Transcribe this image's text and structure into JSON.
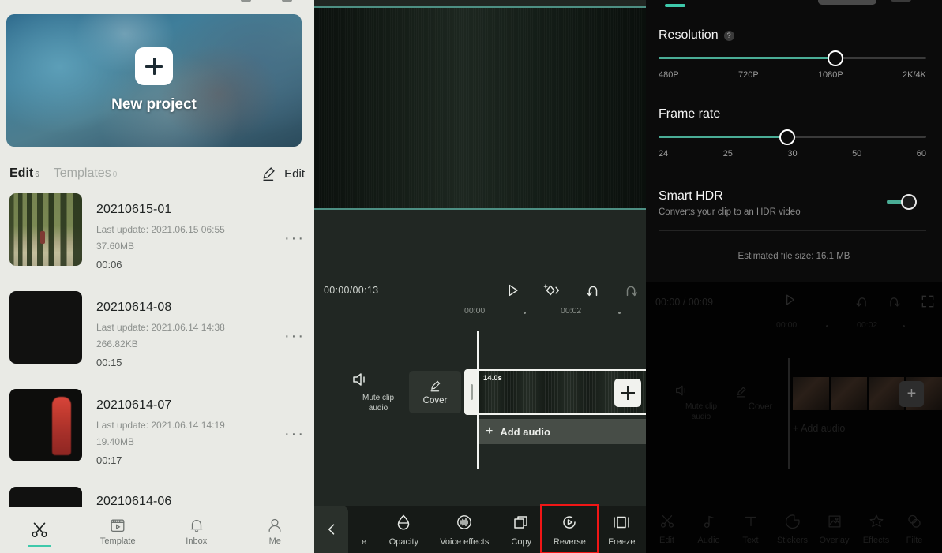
{
  "panels": {
    "projects": {
      "hero": {
        "label": "New project",
        "icon": "plus-icon"
      },
      "tabs": {
        "edit_label": "Edit",
        "edit_count": "6",
        "templates_label": "Templates",
        "templates_count": "0"
      },
      "edit_action": {
        "label": "Edit",
        "icon": "pencil-icon"
      },
      "list_meta": {
        "last_update_prefix": "Last update:"
      },
      "items": [
        {
          "name": "20210615-01",
          "last_update": "Last update: 2021.06.15 06:55",
          "size": "37.60MB",
          "duration": "00:06",
          "thumb": "forest-path",
          "menu": "···"
        },
        {
          "name": "20210614-08",
          "last_update": "Last update: 2021.06.14 14:38",
          "size": "266.82KB",
          "duration": "00:15",
          "thumb": "black",
          "menu": "···"
        },
        {
          "name": "20210614-07",
          "last_update": "Last update: 2021.06.14 14:19",
          "size": "19.40MB",
          "duration": "00:17",
          "thumb": "red-dancer",
          "menu": "···"
        },
        {
          "name": "20210614-06",
          "last_update": "",
          "size": "",
          "duration": "",
          "thumb": "black-cut",
          "menu": ""
        }
      ],
      "bottom_nav": [
        {
          "label": "",
          "icon": "scissors-icon",
          "active": true
        },
        {
          "label": "Template",
          "icon": "template-icon",
          "active": false
        },
        {
          "label": "Inbox",
          "icon": "bell-icon",
          "active": false
        },
        {
          "label": "Me",
          "icon": "person-icon",
          "active": false
        }
      ]
    },
    "editor": {
      "timecode": "00:00/00:13",
      "controls": [
        {
          "name": "play-button",
          "icon": "play-icon"
        },
        {
          "name": "add-keyframe-button",
          "icon": "keyframe-plus-icon"
        },
        {
          "name": "undo-button",
          "icon": "undo-icon"
        },
        {
          "name": "redo-button",
          "icon": "redo-icon"
        }
      ],
      "ruler": {
        "t0": "00:00",
        "t1": "00:02"
      },
      "mute_clip_audio": "Mute clip\naudio",
      "mute_line1": "Mute clip",
      "mute_line2": "audio",
      "cover_label": "Cover",
      "clip_duration": "14.0s",
      "add_clip_label": "+",
      "add_audio_label": "Add audio",
      "add_audio_plus": "+",
      "toolbar": {
        "back_icon": "chevron-left-icon",
        "items": [
          {
            "label": "e",
            "icon": "truncated-icon",
            "highlight": false
          },
          {
            "label": "Opacity",
            "icon": "opacity-icon",
            "highlight": false
          },
          {
            "label": "Voice effects",
            "icon": "voice-effects-icon",
            "highlight": false
          },
          {
            "label": "Copy",
            "icon": "copy-icon",
            "highlight": false
          },
          {
            "label": "Reverse",
            "icon": "reverse-icon",
            "highlight": true
          },
          {
            "label": "Freeze",
            "icon": "freeze-icon",
            "highlight": false
          }
        ]
      },
      "highlight_color": "#f01616",
      "accent_color": "#4d8f83"
    },
    "export_settings": {
      "resolution": {
        "title": "Resolution",
        "help": "?",
        "ticks": [
          "480P",
          "720P",
          "1080P",
          "2K/4K"
        ],
        "selected": "1080P",
        "fill_percent": 66
      },
      "frame_rate": {
        "title": "Frame rate",
        "ticks": [
          "24",
          "25",
          "30",
          "50",
          "60"
        ],
        "selected": "30",
        "fill_percent": 50
      },
      "smart_hdr": {
        "title": "Smart HDR",
        "description": "Converts your clip to an HDR video",
        "enabled": true
      },
      "estimate": "Estimated file size: 16.1 MB",
      "accent_color": "#4aad96",
      "dimmed_editor": {
        "timecode_current": "00:00",
        "timecode_sep": "/",
        "timecode_total": "00:09",
        "ruler": {
          "t0": "00:00",
          "t1": "00:02"
        },
        "mute_line1": "Mute clip",
        "mute_line2": "audio",
        "cover_label": "Cover",
        "add_clip_label": "+",
        "add_audio_label": "+  Add audio",
        "toolbar": [
          {
            "label": "Edit",
            "icon": "scissors-icon"
          },
          {
            "label": "Audio",
            "icon": "music-note-icon"
          },
          {
            "label": "Text",
            "icon": "text-icon"
          },
          {
            "label": "Stickers",
            "icon": "sticker-icon"
          },
          {
            "label": "Overlay",
            "icon": "overlay-icon"
          },
          {
            "label": "Effects",
            "icon": "effects-star-icon"
          },
          {
            "label": "Filte",
            "icon": "filter-icon"
          }
        ]
      }
    }
  }
}
